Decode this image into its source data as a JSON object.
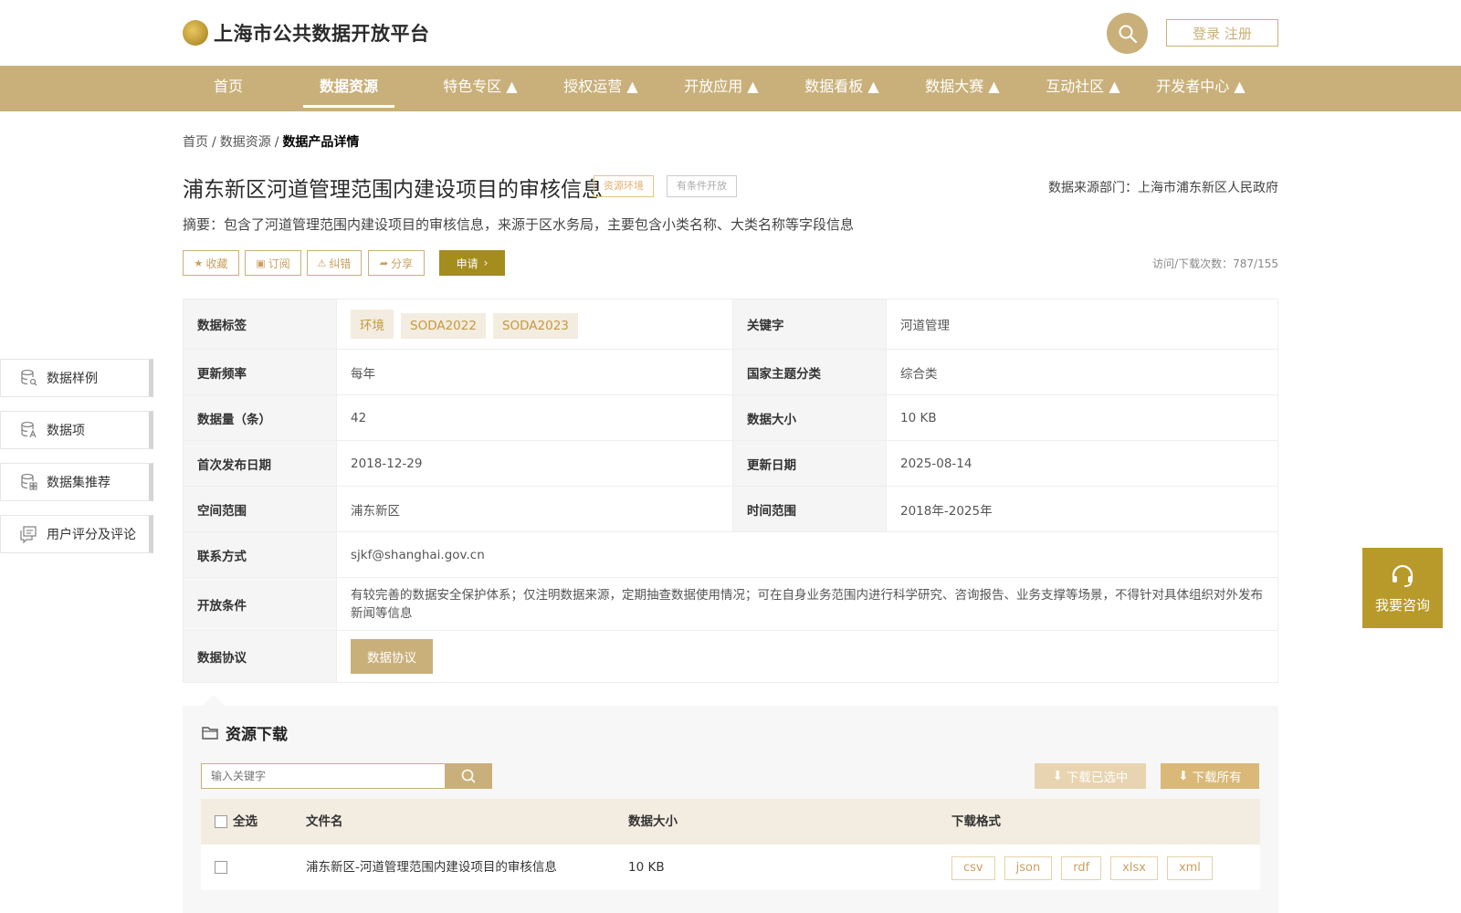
{
  "header": {
    "logo_text": "上海市公共数据开放平台",
    "login_label": "登录 注册"
  },
  "nav": {
    "items": [
      {
        "label": "首页"
      },
      {
        "label": "数据资源"
      },
      {
        "label": "特色专区 ▲"
      },
      {
        "label": "授权运营 ▲"
      },
      {
        "label": "开放应用 ▲"
      },
      {
        "label": "数据看板 ▲"
      },
      {
        "label": "数据大赛 ▲"
      },
      {
        "label": "互动社区 ▲"
      },
      {
        "label": "开发者中心 ▲"
      }
    ],
    "active_index": 1
  },
  "breadcrumb": {
    "home": "首页",
    "section": "数据资源",
    "current": "数据产品详情",
    "separator": "/"
  },
  "product": {
    "title": "浦东新区河道管理范围内建设项目的审核信息",
    "tag_primary": "资源环境",
    "tag_secondary": "有条件开放",
    "source": "数据来源部门：上海市浦东新区人民政府",
    "summary": "摘要：包含了河道管理范围内建设项目的审核信息，来源于区水务局，主要包含小类名称、大类名称等字段信息",
    "visits": "访问/下载次数：787/155"
  },
  "actions": {
    "favorite": "收藏",
    "subscribe": "订阅",
    "correct": "纠错",
    "share": "分享",
    "apply": "申请"
  },
  "info": {
    "tags_label": "数据标签",
    "tags": [
      "环境",
      "SODA2022",
      "SODA2023"
    ],
    "keyword_label": "关键字",
    "keyword": "河道管理",
    "freq_label": "更新频率",
    "freq": "每年",
    "theme_label": "国家主题分类",
    "theme": "综合类",
    "count_label": "数据量（条）",
    "count": "42",
    "size_label": "数据大小",
    "size": "10 KB",
    "first_label": "首次发布日期",
    "first": "2018-12-29",
    "update_label": "更新日期",
    "update": "2025-08-14",
    "space_label": "空间范围",
    "space": "浦东新区",
    "time_label": "时间范围",
    "time": "2018年-2025年",
    "contact_label": "联系方式",
    "contact": "sjkf@shanghai.gov.cn",
    "condition_label": "开放条件",
    "condition": "有较完善的数据安全保护体系；仅注明数据来源，定期抽查数据使用情况；可在自身业务范围内进行科学研究、咨询报告、业务支撑等场景，不得针对具体组织对外发布新闻等信息",
    "protocol_label": "数据协议",
    "protocol_btn": "数据协议"
  },
  "sidebar": {
    "items": [
      {
        "label": "数据样例",
        "icon": "database-search-icon"
      },
      {
        "label": "数据项",
        "icon": "database-text-icon"
      },
      {
        "label": "数据集推荐",
        "icon": "database-grid-icon"
      },
      {
        "label": "用户评分及评论",
        "icon": "comment-icon"
      }
    ]
  },
  "consult": {
    "label": "我要咨询"
  },
  "download": {
    "title": "资源下载",
    "search_placeholder": "输入关键字",
    "download_selected": "下载已选中",
    "download_all": "下载所有",
    "columns": {
      "select_all": "全选",
      "filename": "文件名",
      "size": "数据大小",
      "format": "下载格式"
    },
    "rows": [
      {
        "filename": "浦东新区-河道管理范围内建设项目的审核信息",
        "size": "10 KB",
        "formats": [
          "csv",
          "json",
          "rdf",
          "xlsx",
          "xml"
        ]
      }
    ]
  },
  "colors": {
    "brand": "#c9b07a",
    "brand_dark": "#a48c1f",
    "consult": "#b89a2a"
  }
}
